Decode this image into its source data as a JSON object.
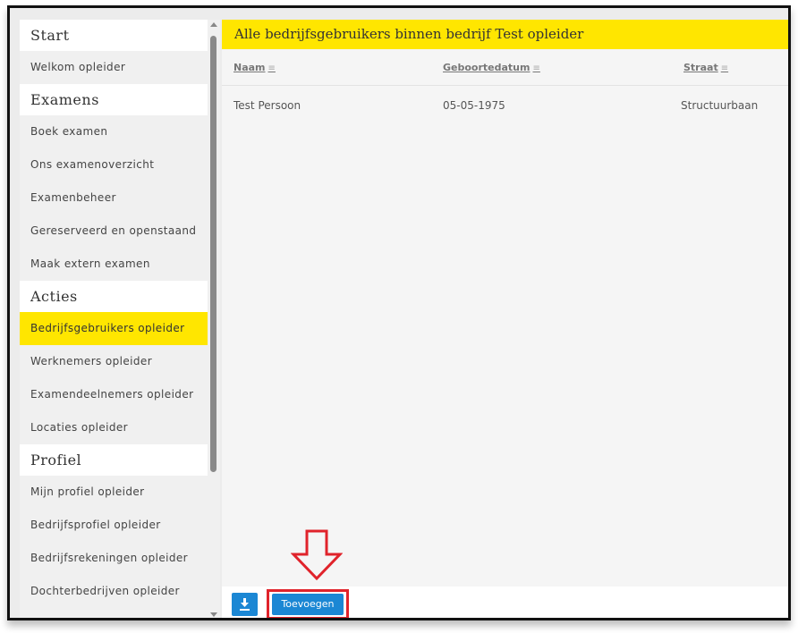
{
  "sidebar": {
    "sections": [
      {
        "heading": "Start",
        "items": [
          "Welkom opleider"
        ]
      },
      {
        "heading": "Examens",
        "items": [
          "Boek examen",
          "Ons examenoverzicht",
          "Examenbeheer",
          "Gereserveerd en openstaand",
          "Maak extern examen"
        ]
      },
      {
        "heading": "Acties",
        "items": [
          "Bedrijfsgebruikers opleider",
          "Werknemers opleider",
          "Examendeelnemers opleider",
          "Locaties opleider"
        ]
      },
      {
        "heading": "Profiel",
        "items": [
          "Mijn profiel opleider",
          "Bedrijfsprofiel opleider",
          "Bedrijfsrekeningen opleider",
          "Dochterbedrijven opleider"
        ]
      }
    ],
    "active_item": "Bedrijfsgebruikers opleider"
  },
  "main": {
    "title": "Alle bedrijfsgebruikers binnen bedrijf Test opleider",
    "columns": [
      "Naam",
      "Geboortedatum",
      "Straat"
    ],
    "rows": [
      [
        "Test Persoon",
        "05-05-1975",
        "Structuurbaan"
      ]
    ]
  },
  "footer": {
    "add_button_label": "Toevoegen",
    "download_icon": "download-icon"
  },
  "colors": {
    "accent_yellow": "#ffe600",
    "button_blue": "#1b87d4",
    "highlight_red": "#e0232b"
  }
}
